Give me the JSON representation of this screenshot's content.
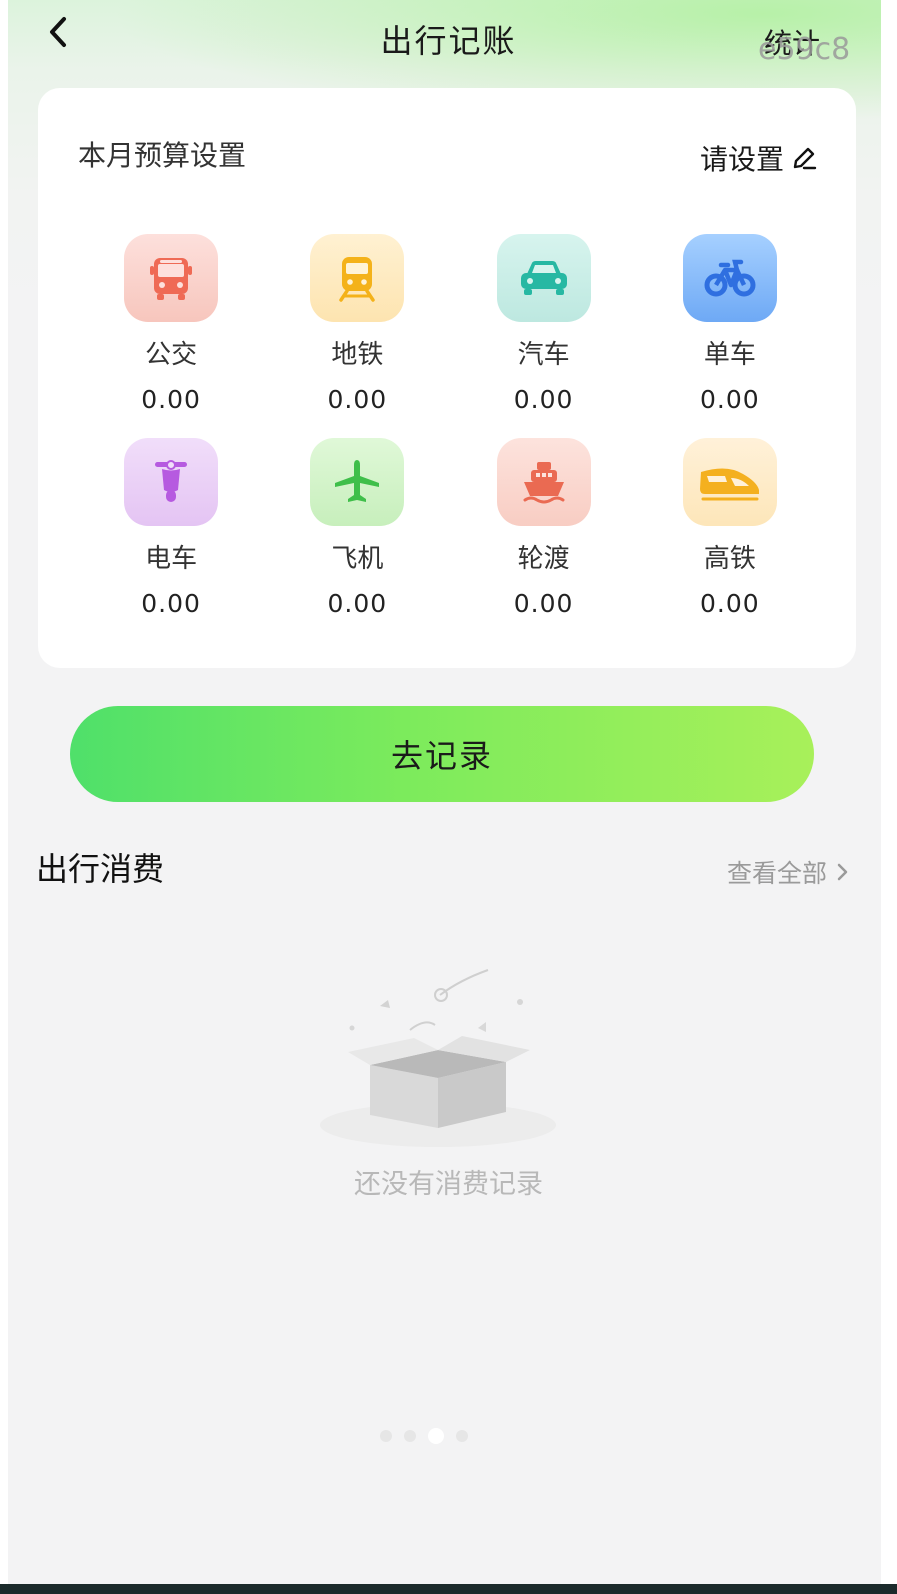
{
  "header": {
    "title": "出行记账",
    "stats_label": "统计",
    "watermark": "e59c8"
  },
  "budget": {
    "title": "本月预算设置",
    "set_label": "请设置"
  },
  "categories": [
    {
      "name": "公交",
      "amount": "0.00",
      "icon": "bus-icon",
      "color": "#ef6a55"
    },
    {
      "name": "地铁",
      "amount": "0.00",
      "icon": "subway-icon",
      "color": "#f4b21a"
    },
    {
      "name": "汽车",
      "amount": "0.00",
      "icon": "car-icon",
      "color": "#27b8a3"
    },
    {
      "name": "单车",
      "amount": "0.00",
      "icon": "bicycle-icon",
      "color": "#2f74e8"
    },
    {
      "name": "电车",
      "amount": "0.00",
      "icon": "scooter-icon",
      "color": "#b65ae0"
    },
    {
      "name": "飞机",
      "amount": "0.00",
      "icon": "airplane-icon",
      "color": "#3fbf4a"
    },
    {
      "name": "轮渡",
      "amount": "0.00",
      "icon": "ferry-icon",
      "color": "#ea6a52"
    },
    {
      "name": "高铁",
      "amount": "0.00",
      "icon": "high-speed-rail-icon",
      "color": "#f4b01f"
    }
  ],
  "record_button": {
    "label": "去记录"
  },
  "expenses": {
    "title": "出行消费",
    "view_all": "查看全部",
    "empty_text": "还没有消费记录"
  },
  "colors": {
    "accent_start": "#4fe06a",
    "accent_end": "#a8f05a"
  }
}
